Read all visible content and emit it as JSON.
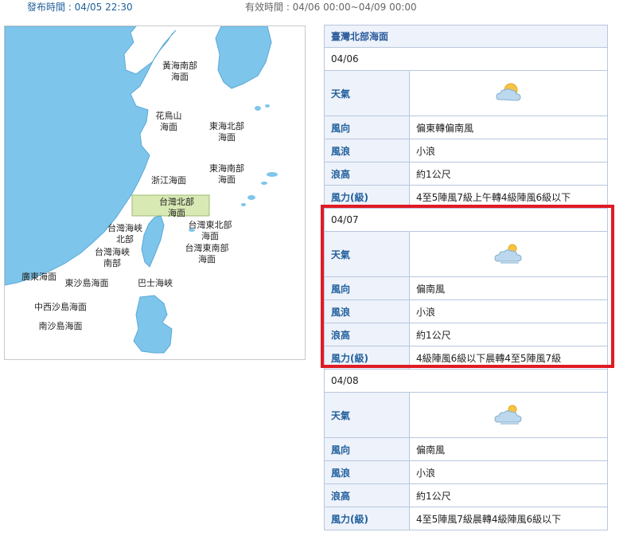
{
  "header": {
    "publish_time": "發布時間 : 04/05 22:30",
    "valid_time": "有效時間 : 04/06 00:00~04/09 00:00"
  },
  "map": {
    "labels": {
      "huanghai_south": "黃海南部\n海面",
      "huaniaoshan": "花鳥山\n海面",
      "donghai_north": "東海北部\n海面",
      "donghai_south": "東海南部\n海面",
      "zhejiang": "浙江海面",
      "taiwan_north": "台灣北部\n海面",
      "taiwan_northeast": "台灣東北部\n海面",
      "taiwan_strait_north": "台灣海峽\n北部",
      "taiwan_strait_south": "台灣海峽\n南部",
      "taiwan_southeast": "台灣東南部\n海面",
      "guangdong": "廣東海面",
      "dongsha": "東沙島海面",
      "bashi": "巴士海峽",
      "zhongxisha": "中西沙島海面",
      "nansha": "南沙島海面"
    }
  },
  "forecast": {
    "region": "臺灣北部海面",
    "labels": {
      "weather": "天氣",
      "wind_dir": "風向",
      "wave": "風浪",
      "wave_height": "浪高",
      "wind_force": "風力(級)"
    },
    "days": [
      {
        "date": "04/06",
        "weather_icon": "partly-cloudy-icon",
        "wind_dir": "偏東轉偏南風",
        "wave": "小浪",
        "wave_height": "約1公尺",
        "wind_force": "4至5陣風7級上午轉4級陣風6級以下"
      },
      {
        "date": "04/07",
        "weather_icon": "cloudy-icon",
        "wind_dir": "偏南風",
        "wave": "小浪",
        "wave_height": "約1公尺",
        "wind_force": "4級陣風6級以下晨轉4至5陣風7級"
      },
      {
        "date": "04/08",
        "weather_icon": "cloudy-icon",
        "wind_dir": "偏南風",
        "wave": "小浪",
        "wave_height": "約1公尺",
        "wind_force": "4至5陣風7級晨轉4級陣風6級以下"
      }
    ]
  },
  "colors": {
    "sea_blue": "#7ec5ec",
    "highlight_zone": "#d9e9b4",
    "label_blue": "#1f5f9c",
    "table_border": "#b8c7de",
    "highlight_frame": "#e01b24"
  }
}
